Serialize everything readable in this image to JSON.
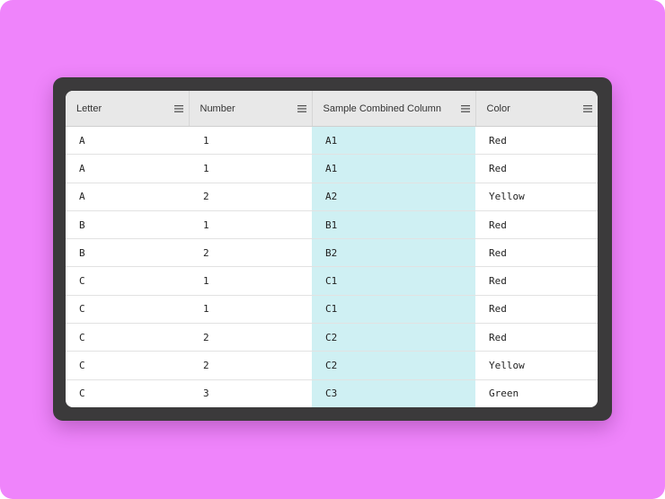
{
  "grid": {
    "columns": [
      {
        "label": "Letter"
      },
      {
        "label": "Number"
      },
      {
        "label": "Sample Combined Column"
      },
      {
        "label": "Color"
      }
    ],
    "rows": [
      {
        "letter": "A",
        "number": "1",
        "combined": "A1",
        "color": "Red"
      },
      {
        "letter": "A",
        "number": "1",
        "combined": "A1",
        "color": "Red"
      },
      {
        "letter": "A",
        "number": "2",
        "combined": "A2",
        "color": "Yellow"
      },
      {
        "letter": "B",
        "number": "1",
        "combined": "B1",
        "color": "Red"
      },
      {
        "letter": "B",
        "number": "2",
        "combined": "B2",
        "color": "Red"
      },
      {
        "letter": "C",
        "number": "1",
        "combined": "C1",
        "color": "Red"
      },
      {
        "letter": "C",
        "number": "1",
        "combined": "C1",
        "color": "Red"
      },
      {
        "letter": "C",
        "number": "2",
        "combined": "C2",
        "color": "Red"
      },
      {
        "letter": "C",
        "number": "2",
        "combined": "C2",
        "color": "Yellow"
      },
      {
        "letter": "C",
        "number": "3",
        "combined": "C3",
        "color": "Green"
      }
    ],
    "header_menu_icon": "menu-icon",
    "highlighted_column_color": "#cff0f3"
  },
  "colors": {
    "background": "#ef84fb",
    "frame": "#3b3a3b",
    "header_bg": "#e8e8e8"
  }
}
